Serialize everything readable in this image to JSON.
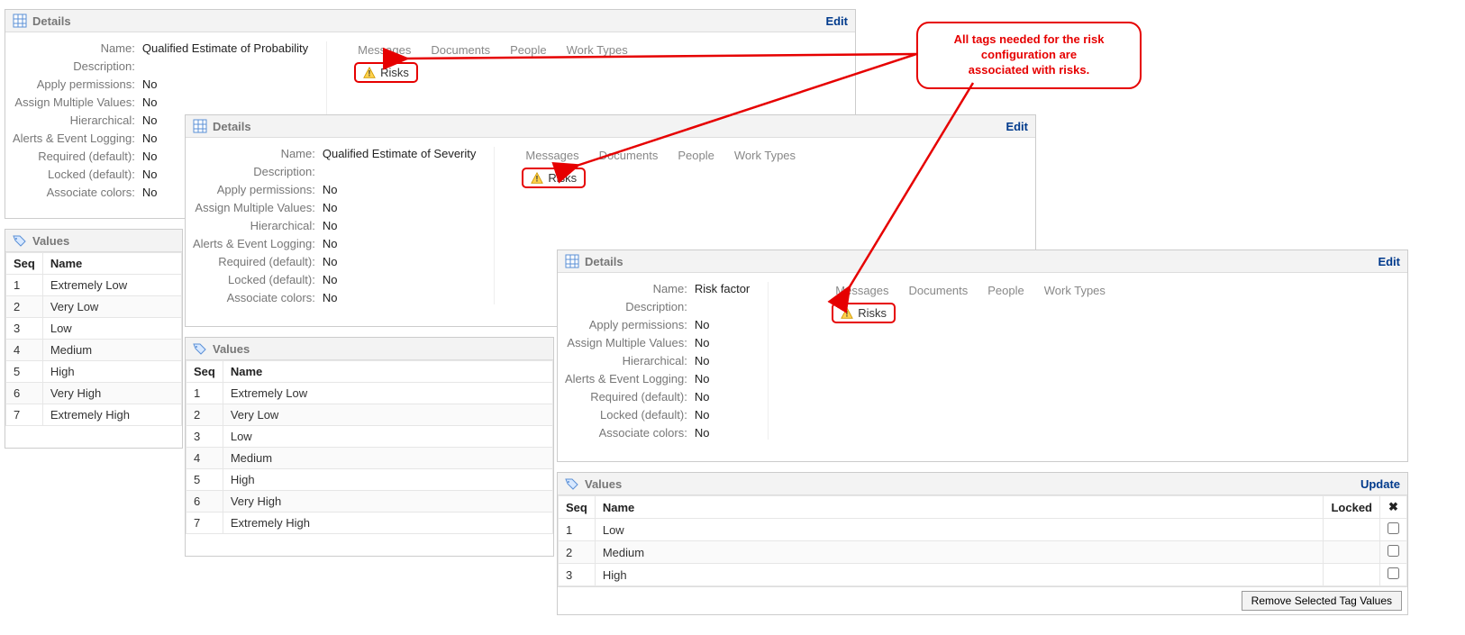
{
  "labels": {
    "details": "Details",
    "values": "Values",
    "edit": "Edit",
    "update": "Update",
    "name": "Name:",
    "description": "Description:",
    "apply_permissions": "Apply permissions:",
    "assign_multiple": "Assign Multiple Values:",
    "hierarchical": "Hierarchical:",
    "alerts": "Alerts & Event Logging:",
    "required": "Required (default):",
    "locked": "Locked (default):",
    "associate_colors": "Associate colors:",
    "seq": "Seq",
    "nameCol": "Name",
    "lockedCol": "Locked",
    "remove": "Remove Selected Tag Values"
  },
  "tabs": [
    "Messages",
    "Documents",
    "People",
    "Work Types"
  ],
  "risks": "Risks",
  "no": "No",
  "panel1": {
    "name": "Qualified Estimate of Probability",
    "rows": [
      {
        "seq": "1",
        "name": "Extremely Low"
      },
      {
        "seq": "2",
        "name": "Very Low"
      },
      {
        "seq": "3",
        "name": "Low"
      },
      {
        "seq": "4",
        "name": "Medium"
      },
      {
        "seq": "5",
        "name": "High"
      },
      {
        "seq": "6",
        "name": "Very High"
      },
      {
        "seq": "7",
        "name": "Extremely High"
      }
    ]
  },
  "panel2": {
    "name": "Qualified Estimate of Severity",
    "rows": [
      {
        "seq": "1",
        "name": "Extremely Low"
      },
      {
        "seq": "2",
        "name": "Very Low"
      },
      {
        "seq": "3",
        "name": "Low"
      },
      {
        "seq": "4",
        "name": "Medium"
      },
      {
        "seq": "5",
        "name": "High"
      },
      {
        "seq": "6",
        "name": "Very High"
      },
      {
        "seq": "7",
        "name": "Extremely High"
      }
    ]
  },
  "panel3": {
    "name": "Risk factor",
    "rows": [
      {
        "seq": "1",
        "name": "Low"
      },
      {
        "seq": "2",
        "name": "Medium"
      },
      {
        "seq": "3",
        "name": "High"
      }
    ]
  },
  "callout": {
    "line1": "All tags needed for the risk",
    "line2": "configuration are",
    "line3": "associated with risks."
  }
}
